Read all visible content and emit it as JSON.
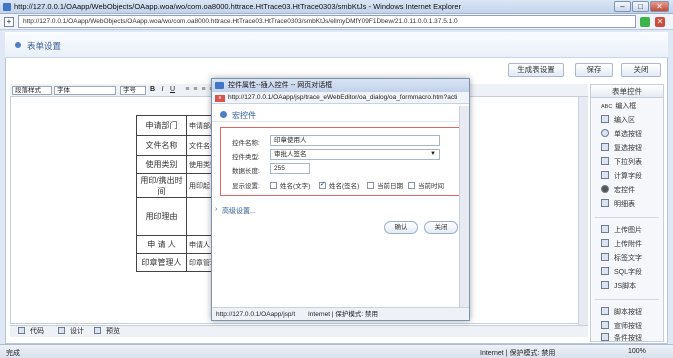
{
  "window": {
    "title": "http://127.0.0.1/OAapp/WebObjects/OAapp.woa/wo/com.oa8000.httrace.HtTrace03.HtTrace0303/smbKtJs - Windows Internet Explorer",
    "address": "http://127.0.0.1/OAapp/WebObjects/OAapp.woa/wo/com.oa8000.httrace.HtTrace03.HtTrace0303/smbKtJs/ellmyDMfY09F1Dbew/21.0.11.0.0.1.37.5.1.0"
  },
  "page": {
    "header_title": "表单设置",
    "buttons": {
      "generate": "生成表设置",
      "save": "保存",
      "close": "关闭"
    }
  },
  "editor": {
    "toolbar": {
      "style": "段落样式",
      "font": "字体",
      "size": "字号",
      "bold": "B",
      "italic": "I",
      "underline": "U"
    },
    "rows": [
      {
        "label": "申请部门",
        "value": "申请部门"
      },
      {
        "label": "文件名称",
        "value": "文件名称"
      },
      {
        "label": "使用类别",
        "value": "使用类别"
      },
      {
        "label": "用印/携出时间",
        "value": "用印起"
      },
      {
        "label": "用印理由",
        "value": ""
      },
      {
        "label": "申 请 人",
        "value": "申请人 (印"
      },
      {
        "label": "印章管理人",
        "value": "印章管理"
      }
    ],
    "tabs": {
      "code": "代码",
      "design": "设计",
      "preview": "预览"
    }
  },
  "right_panel": {
    "title": "表单控件",
    "items": [
      "编入框",
      "编入区",
      "单选按钮",
      "复选按钮",
      "下拉列表",
      "计算字段",
      "宏控件",
      "明细表",
      "上传图片",
      "上传附件",
      "标签文字",
      "SQL字段",
      "JS脚本",
      "脚本按钮",
      "宣师按钮",
      "条件按钮"
    ],
    "prefix_first": "ABC"
  },
  "popup": {
    "title": "控件属性--插入控件 -- 网页对话框",
    "address": "http://127.0.0.1/OAapp/jsp/trace_eWebEditor/oa_dialog/oa_formmacro.htm?acti",
    "section": "宏控件",
    "fields": {
      "name_label": "控件名称:",
      "name_value": "印章使用人",
      "type_label": "控件类型:",
      "type_value": "审批人签名",
      "length_label": "数据长度:",
      "length_value": "255",
      "display_label": "显示设置:"
    },
    "checkboxes": [
      {
        "label": "姓名(文字)",
        "checked": false
      },
      {
        "label": "姓名(签名)",
        "checked": true
      },
      {
        "label": "当前日期",
        "checked": false
      },
      {
        "label": "当前时间",
        "checked": false
      }
    ],
    "advanced": "高级设置...",
    "ok": "确认",
    "cancel": "关闭",
    "status": "http://127.0.0.1/OAapp/jsp/t",
    "zone": "Internet | 保护模式: 禁用"
  },
  "status": {
    "left": "完成",
    "zone": "Internet | 保护模式: 禁用",
    "zoom": "100%"
  }
}
